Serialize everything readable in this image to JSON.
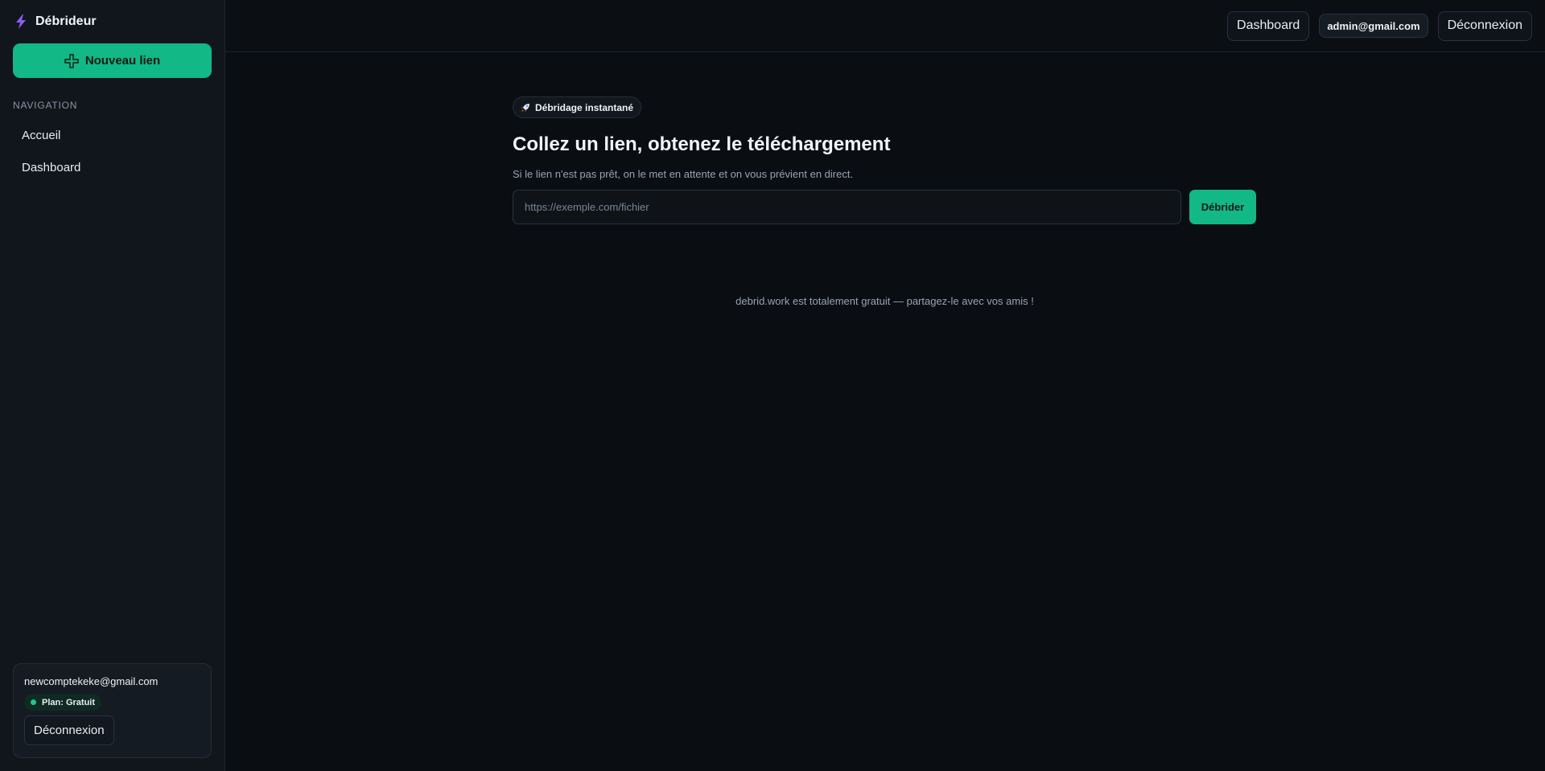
{
  "sidebar": {
    "brand_name": "Débrideur",
    "new_link_label": "Nouveau lien",
    "nav_heading": "NAVIGATION",
    "items": [
      {
        "label": "Accueil"
      },
      {
        "label": "Dashboard"
      }
    ],
    "account": {
      "email": "newcomptekeke@gmail.com",
      "plan": "Plan: Gratuit",
      "logout_label": "Déconnexion"
    }
  },
  "topbar": {
    "dashboard_label": "Dashboard",
    "user_email": "admin@gmail.com",
    "logout_label": "Déconnexion"
  },
  "main": {
    "pill_label": "Débridage instantané",
    "headline": "Collez un lien, obtenez le téléchargement",
    "subtext": "Si le lien n'est pas prêt, on le met en attente et on vous prévient en direct.",
    "input_placeholder": "https://exemple.com/fichier",
    "input_value": "",
    "submit_label": "Débrider",
    "footer_note": "debrid.work est totalement gratuit — partagez-le avec vos amis !"
  },
  "colors": {
    "accent": "#12b886",
    "brand_icon": "#8b5cf6",
    "background": "#0a0d12",
    "sidebar": "#11161d"
  },
  "icons": {
    "brand": "lightning-bolt-icon",
    "new_link": "plus-icon",
    "pill": "rocket-icon",
    "plan_status": "status-dot-icon"
  }
}
